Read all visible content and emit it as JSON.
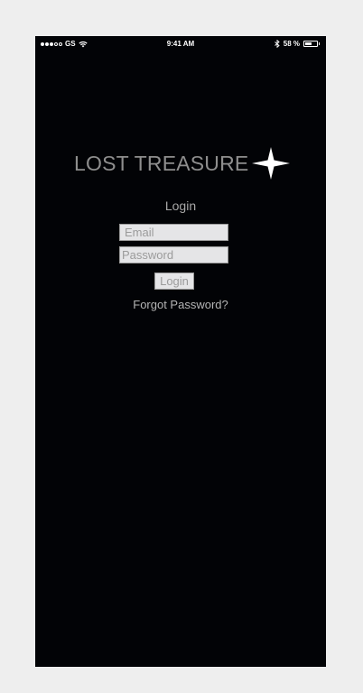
{
  "status_bar": {
    "carrier": "GS",
    "time": "9:41 AM",
    "battery_text": "58 %",
    "battery_level": 0.58,
    "signal_bars_filled": 3,
    "signal_bars_total": 5
  },
  "header": {
    "title": "LOST TREASURE",
    "logo_icon": "four-point-star-icon"
  },
  "login": {
    "heading": "Login",
    "email_placeholder": "Email",
    "password_placeholder": "Password",
    "button_label": "Login",
    "forgot_label": "Forgot Password?"
  },
  "colors": {
    "screen_background": "#020306",
    "page_background": "#eeeeee",
    "title": "#8e8e8e",
    "field_background": "#e5e5e7"
  }
}
